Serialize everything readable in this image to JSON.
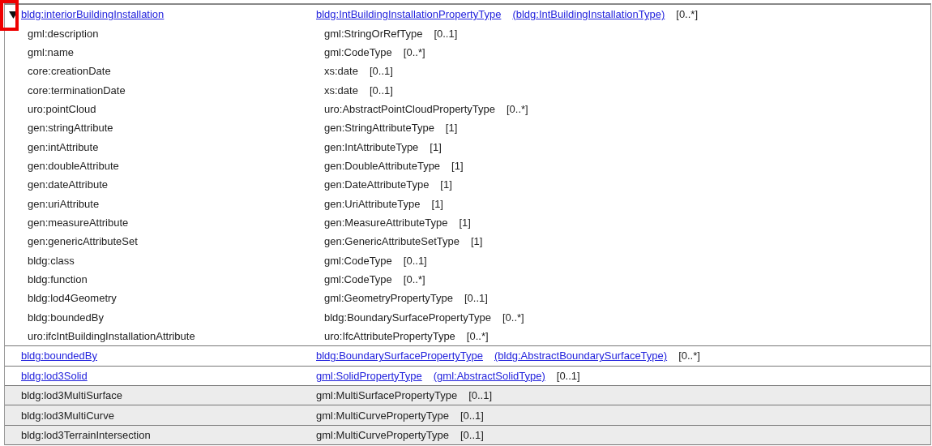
{
  "rows": [
    {
      "name": "bldg:interiorBuildingInstallation",
      "type": "bldg:IntBuildingInstallationPropertyType",
      "ref_type": "(bldg:IntBuildingInstallationType)",
      "multiplicity": "[0..*]",
      "linked": true,
      "expanded": true,
      "highlighted": true,
      "children": [
        {
          "name": "gml:description",
          "type": "gml:StringOrRefType",
          "multiplicity": "[0..1]"
        },
        {
          "name": "gml:name",
          "type": "gml:CodeType",
          "multiplicity": "[0..*]"
        },
        {
          "name": "core:creationDate",
          "type": "xs:date",
          "multiplicity": "[0..1]"
        },
        {
          "name": "core:terminationDate",
          "type": "xs:date",
          "multiplicity": "[0..1]"
        },
        {
          "name": "uro:pointCloud",
          "type": "uro:AbstractPointCloudPropertyType",
          "multiplicity": "[0..*]"
        },
        {
          "name": "gen:stringAttribute",
          "type": "gen:StringAttributeType",
          "multiplicity": "[1]"
        },
        {
          "name": "gen:intAttribute",
          "type": "gen:IntAttributeType",
          "multiplicity": "[1]"
        },
        {
          "name": "gen:doubleAttribute",
          "type": "gen:DoubleAttributeType",
          "multiplicity": "[1]"
        },
        {
          "name": "gen:dateAttribute",
          "type": "gen:DateAttributeType",
          "multiplicity": "[1]"
        },
        {
          "name": "gen:uriAttribute",
          "type": "gen:UriAttributeType",
          "multiplicity": "[1]"
        },
        {
          "name": "gen:measureAttribute",
          "type": "gen:MeasureAttributeType",
          "multiplicity": "[1]"
        },
        {
          "name": "gen:genericAttributeSet",
          "type": "gen:GenericAttributeSetType",
          "multiplicity": "[1]"
        },
        {
          "name": "bldg:class",
          "type": "gml:CodeType",
          "multiplicity": "[0..1]"
        },
        {
          "name": "bldg:function",
          "type": "gml:CodeType",
          "multiplicity": "[0..*]"
        },
        {
          "name": "bldg:lod4Geometry",
          "type": "gml:GeometryPropertyType",
          "multiplicity": "[0..1]"
        },
        {
          "name": "bldg:boundedBy",
          "type": "bldg:BoundarySurfacePropertyType",
          "multiplicity": "[0..*]"
        },
        {
          "name": "uro:ifcIntBuildingInstallationAttribute",
          "type": "uro:IfcAttributePropertyType",
          "multiplicity": "[0..*]"
        }
      ]
    },
    {
      "name": "bldg:boundedBy",
      "type": "bldg:BoundarySurfacePropertyType",
      "ref_type": "(bldg:AbstractBoundarySurfaceType)",
      "multiplicity": "[0..*]",
      "linked": true
    },
    {
      "name": "bldg:lod3Solid",
      "type": "gml:SolidPropertyType",
      "ref_type": "(gml:AbstractSolidType)",
      "multiplicity": "[0..1]",
      "linked": true
    },
    {
      "name": "bldg:lod3MultiSurface",
      "type": "gml:MultiSurfacePropertyType",
      "multiplicity": "[0..1]",
      "linked": false
    },
    {
      "name": "bldg:lod3MultiCurve",
      "type": "gml:MultiCurvePropertyType",
      "multiplicity": "[0..1]",
      "linked": false
    },
    {
      "name": "bldg:lod3TerrainIntersection",
      "type": "gml:MultiCurvePropertyType",
      "multiplicity": "[0..1]",
      "linked": false
    }
  ]
}
